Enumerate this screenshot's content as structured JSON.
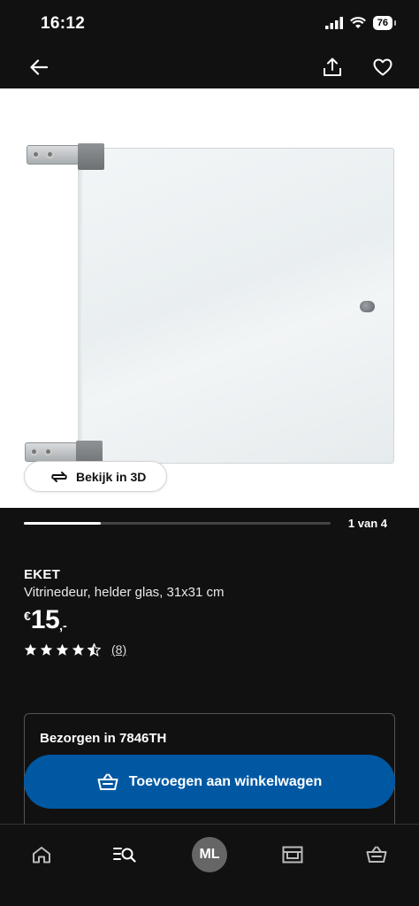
{
  "status_bar": {
    "time": "16:12",
    "battery": "76"
  },
  "product": {
    "name": "EKET",
    "description": "Vitrinedeur, helder glas, 31x31 cm",
    "price_currency": "€",
    "price_integer": "15",
    "price_decimal": ",-",
    "rating": 4.5,
    "review_count": "(8)"
  },
  "gallery": {
    "view_3d_label": "Bekijk in 3D",
    "counter": "1 van 4",
    "progress": 0.25
  },
  "delivery": {
    "title": "Bezorgen in 7846TH"
  },
  "actions": {
    "add_to_cart": "Toevoegen aan winkelwagen"
  },
  "bottom_nav": {
    "avatar_initials": "ML"
  },
  "colors": {
    "accent_blue": "#0058a3",
    "background": "#111111"
  }
}
